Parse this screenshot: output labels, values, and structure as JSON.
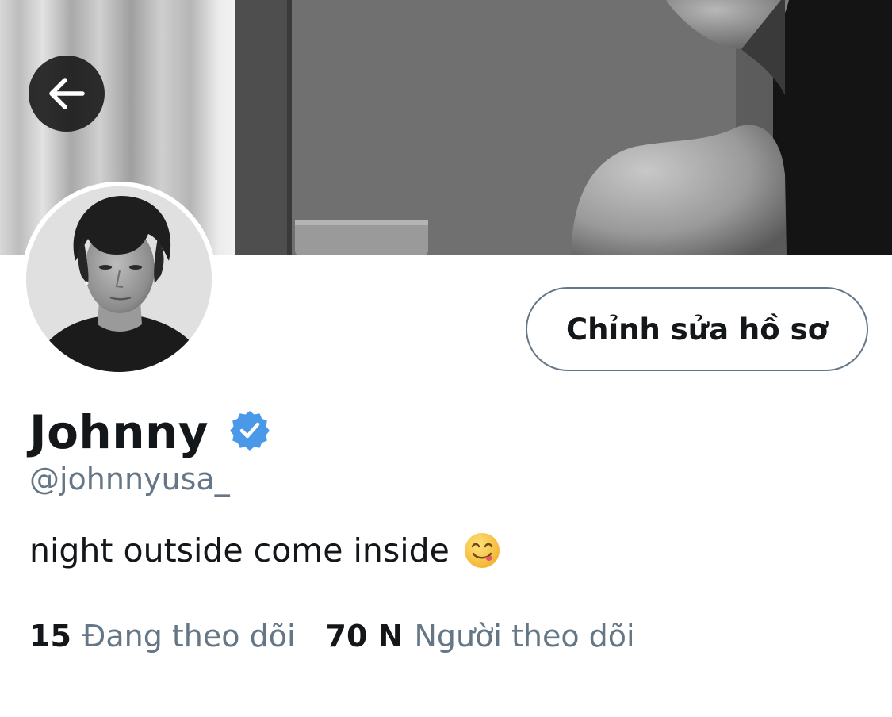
{
  "profile": {
    "edit_button_label": "Chỉnh sửa hồ sơ",
    "display_name": "Johnny",
    "handle": "@johnnyusa_",
    "bio": "night outside come inside",
    "bio_emoji": "face-savoring-food-emoji",
    "verified": true,
    "verified_color": "#4a99e9"
  },
  "stats": {
    "following_count": "15",
    "following_label": "Đang theo dõi",
    "followers_count": "70 N",
    "followers_label": "Người theo dõi"
  },
  "icons": {
    "back": "arrow-left-icon",
    "verified": "verified-badge-icon"
  },
  "colors": {
    "text_primary": "#14171a",
    "text_secondary": "#657786",
    "button_border": "#657786",
    "back_button_bg": "#141414"
  }
}
